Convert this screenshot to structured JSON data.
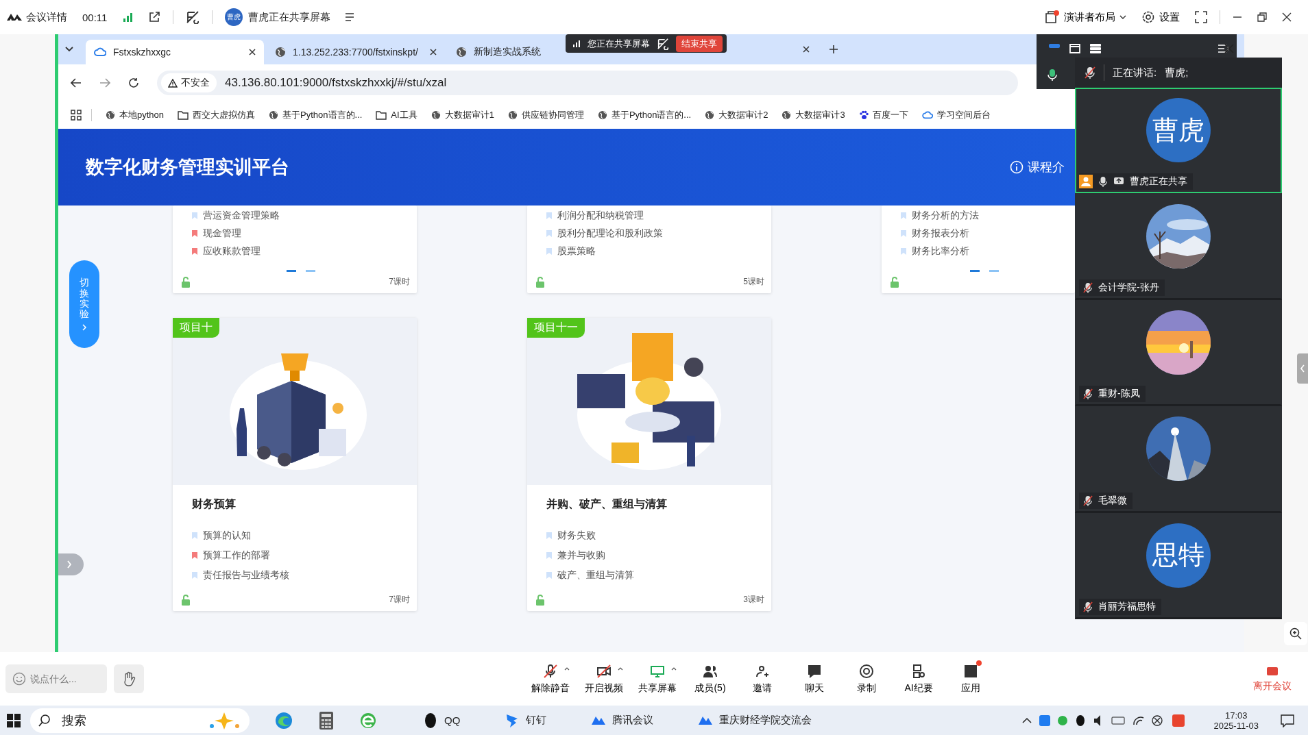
{
  "meeting_bar": {
    "title": "会议详情",
    "timer": "00:11",
    "sharer_avatar": "曹虎",
    "sharing_label": "曹虎正在共享屏幕",
    "layout_button": "演讲者布局",
    "layout_badge": true,
    "settings": "设置"
  },
  "share_pill": {
    "label": "您正在共享屏幕",
    "stop": "结束共享"
  },
  "browser": {
    "tabs": [
      {
        "title": "Fstxskzhxxgc",
        "kind": "cloud",
        "selected": true
      },
      {
        "title": "1.13.252.233:7700/fstxinskpt/",
        "kind": "globe",
        "selected": false
      },
      {
        "title": "新制造实战系统",
        "kind": "globe",
        "selected": false
      }
    ],
    "security": "不安全",
    "url": "43.136.80.101:9000/fstxskzhxxkj/#/stu/xzal",
    "bookmarks": [
      {
        "label": "本地python",
        "kind": "globe"
      },
      {
        "label": "西交大虚拟仿真",
        "kind": "folder"
      },
      {
        "label": "基于Python语言的...",
        "kind": "globe"
      },
      {
        "label": "AI工具",
        "kind": "folder"
      },
      {
        "label": "大数据审计1",
        "kind": "globe"
      },
      {
        "label": "供应链协同管理",
        "kind": "globe"
      },
      {
        "label": "基于Python语言的...",
        "kind": "globe"
      },
      {
        "label": "大数据审计2",
        "kind": "globe"
      },
      {
        "label": "大数据审计3",
        "kind": "globe"
      },
      {
        "label": "百度一下",
        "kind": "paw"
      },
      {
        "label": "学习空间后台",
        "kind": "cloud"
      }
    ]
  },
  "page": {
    "title": "数字化财务管理实训平台",
    "intro_link": "课程介",
    "switch_button": "切换实验",
    "top_cards": [
      {
        "topics": [
          {
            "text": "营运资金管理策略",
            "highlighted": false
          },
          {
            "text": "现金管理",
            "highlighted": true
          },
          {
            "text": "应收账款管理",
            "highlighted": true
          }
        ],
        "pager": [
          {
            "selected": true
          },
          {
            "selected": false
          }
        ],
        "hours": "7课时"
      },
      {
        "topics": [
          {
            "text": "利润分配和纳税管理",
            "highlighted": false
          },
          {
            "text": "股利分配理论和股利政策",
            "highlighted": false
          },
          {
            "text": "股票策略",
            "highlighted": false
          }
        ],
        "hours": "5课时"
      },
      {
        "topics": [
          {
            "text": "财务分析的方法",
            "highlighted": false
          },
          {
            "text": "财务报表分析",
            "highlighted": false
          },
          {
            "text": "财务比率分析",
            "highlighted": false
          }
        ],
        "pager": [
          {
            "selected": true
          },
          {
            "selected": false
          }
        ]
      }
    ],
    "cards": [
      {
        "badge": "项目十",
        "title": "财务预算",
        "kind": "trophy",
        "topics": [
          {
            "text": "预算的认知",
            "highlighted": false
          },
          {
            "text": "预算工作的部署",
            "highlighted": true
          },
          {
            "text": "责任报告与业绩考核",
            "highlighted": false
          }
        ],
        "hours": "7课时"
      },
      {
        "badge": "项目十一",
        "title": "并购、破产、重组与清算",
        "kind": "bulb",
        "topics": [
          {
            "text": "财务失败",
            "highlighted": false
          },
          {
            "text": "兼并与收购",
            "highlighted": false
          },
          {
            "text": "破产、重组与清算",
            "highlighted": false
          }
        ],
        "hours": "3课时"
      }
    ]
  },
  "speaker_panel": {
    "speaking_label": "正在讲话:",
    "speaker": "曹虎;",
    "participants": [
      {
        "name": "曹虎正在共享",
        "avatar": {
          "kind": "initials",
          "text": "曹虎"
        },
        "host": true,
        "muted": false,
        "sharing": true,
        "active": true
      },
      {
        "name": "会计学院-张丹",
        "host": false,
        "muted": true,
        "sharing": false,
        "active": false
      },
      {
        "name": "重财-陈凤",
        "host": false,
        "muted": true,
        "sharing": false,
        "active": false
      },
      {
        "name": "毛翠微",
        "host": false,
        "muted": true,
        "sharing": false,
        "active": false
      },
      {
        "name": "肖丽芳福思特",
        "avatar": {
          "kind": "initials",
          "text": "思特"
        },
        "host": false,
        "muted": true,
        "sharing": false,
        "active": false
      }
    ]
  },
  "toolbar": {
    "chat_placeholder": "说点什么...",
    "buttons": [
      {
        "label": "解除静音",
        "menu": true,
        "badge": false
      },
      {
        "label": "开启视频",
        "menu": true,
        "badge": false
      },
      {
        "label": "共享屏幕",
        "menu": true,
        "badge": false
      },
      {
        "label": "成员(5)",
        "menu": false,
        "badge": false
      },
      {
        "label": "邀请",
        "menu": false,
        "badge": false
      },
      {
        "label": "聊天",
        "menu": false,
        "badge": false
      },
      {
        "label": "录制",
        "menu": false,
        "badge": false
      },
      {
        "label": "AI纪要",
        "menu": false,
        "badge": false
      },
      {
        "label": "应用",
        "menu": false,
        "badge": true
      }
    ],
    "leave": "离开会议"
  },
  "taskbar": {
    "search": "搜索",
    "apps": [
      {
        "label": "QQ"
      },
      {
        "label": "钉钉"
      },
      {
        "label": "腾讯会议"
      },
      {
        "label": "重庆财经学院交流会"
      }
    ],
    "time": "17:03",
    "date": "2025-11-03"
  }
}
